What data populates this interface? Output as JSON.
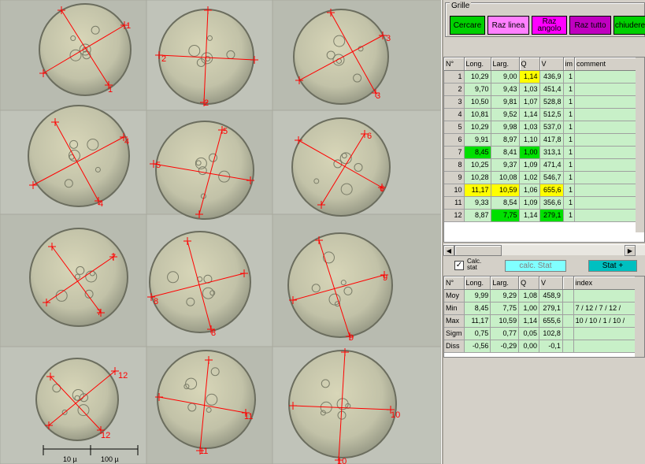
{
  "scale_bar": {
    "label_left": "10 µ",
    "label_right": "100 µ"
  },
  "cells": [
    {
      "n": "1"
    },
    {
      "n": "2"
    },
    {
      "n": "3"
    },
    {
      "n": "4"
    },
    {
      "n": "5"
    },
    {
      "n": "6"
    },
    {
      "n": "7"
    },
    {
      "n": "8"
    },
    {
      "n": "9"
    },
    {
      "n": "10"
    },
    {
      "n": "11"
    },
    {
      "n": "12"
    }
  ],
  "grille": {
    "title": "Grille",
    "buttons": [
      {
        "label": "Cercare",
        "color": "#00d000"
      },
      {
        "label": "Raz linea",
        "color": "#ff80ff"
      },
      {
        "label": "Raz angolo",
        "color": "#ff00ff"
      },
      {
        "label": "Raz tutto",
        "color": "#c000c0"
      },
      {
        "label": "chiudere",
        "color": "#00d000"
      }
    ]
  },
  "measure_table": {
    "headers": [
      "N°",
      "Long.",
      "Larg.",
      "Q",
      "V",
      "im",
      "comment"
    ],
    "rows": [
      {
        "n": "1",
        "long": "10,29",
        "larg": "9,00",
        "q": "1,14",
        "v": "436,9",
        "im": "1",
        "comment": ""
      },
      {
        "n": "2",
        "long": "9,70",
        "larg": "9,43",
        "q": "1,03",
        "v": "451,4",
        "im": "1",
        "comment": ""
      },
      {
        "n": "3",
        "long": "10,50",
        "larg": "9,81",
        "q": "1,07",
        "v": "528,8",
        "im": "1",
        "comment": ""
      },
      {
        "n": "4",
        "long": "10,81",
        "larg": "9,52",
        "q": "1,14",
        "v": "512,5",
        "im": "1",
        "comment": ""
      },
      {
        "n": "5",
        "long": "10,29",
        "larg": "9,98",
        "q": "1,03",
        "v": "537,0",
        "im": "1",
        "comment": ""
      },
      {
        "n": "6",
        "long": "9,91",
        "larg": "8,97",
        "q": "1,10",
        "v": "417,8",
        "im": "1",
        "comment": ""
      },
      {
        "n": "7",
        "long": "8,45",
        "larg": "8,41",
        "q": "1,00",
        "v": "313,1",
        "im": "1",
        "comment": ""
      },
      {
        "n": "8",
        "long": "10,25",
        "larg": "9,37",
        "q": "1,09",
        "v": "471,4",
        "im": "1",
        "comment": ""
      },
      {
        "n": "9",
        "long": "10,28",
        "larg": "10,08",
        "q": "1,02",
        "v": "546,7",
        "im": "1",
        "comment": ""
      },
      {
        "n": "10",
        "long": "11,17",
        "larg": "10,59",
        "q": "1,06",
        "v": "655,6",
        "im": "1",
        "comment": ""
      },
      {
        "n": "11",
        "long": "9,33",
        "larg": "8,54",
        "q": "1,09",
        "v": "356,6",
        "im": "1",
        "comment": ""
      },
      {
        "n": "12",
        "long": "8,87",
        "larg": "7,75",
        "q": "1,14",
        "v": "279,1",
        "im": "1",
        "comment": ""
      }
    ],
    "highlights": {
      "yellow": "#ffff00",
      "green": "#00e000"
    }
  },
  "stat_bar": {
    "checkbox_checked": true,
    "checkbox_label": "Calc. stat",
    "calc_button": "calc. Stat",
    "calc_color": "#80ffff",
    "stat_plus_button": "Stat +",
    "stat_plus_color": "#00c0c0"
  },
  "stat_table": {
    "headers": [
      "N°",
      "Long.",
      "Larg.",
      "Q",
      "V",
      "",
      "index"
    ],
    "rows": [
      {
        "label": "Moy",
        "long": "9,99",
        "larg": "9,29",
        "q": "1,08",
        "v": "458,9",
        "index": ""
      },
      {
        "label": "Min",
        "long": "8,45",
        "larg": "7,75",
        "q": "1,00",
        "v": "279,1",
        "index": "7 / 12 / 7 / 12 /"
      },
      {
        "label": "Max",
        "long": "11,17",
        "larg": "10,59",
        "q": "1,14",
        "v": "655,6",
        "index": "10 / 10 / 1 / 10 /"
      },
      {
        "label": "Sigm",
        "long": "0,75",
        "larg": "0,77",
        "q": "0,05",
        "v": "102,8",
        "index": ""
      },
      {
        "label": "Diss",
        "long": "-0,56",
        "larg": "-0,29",
        "q": "0,00",
        "v": "-0,1",
        "index": ""
      }
    ]
  }
}
